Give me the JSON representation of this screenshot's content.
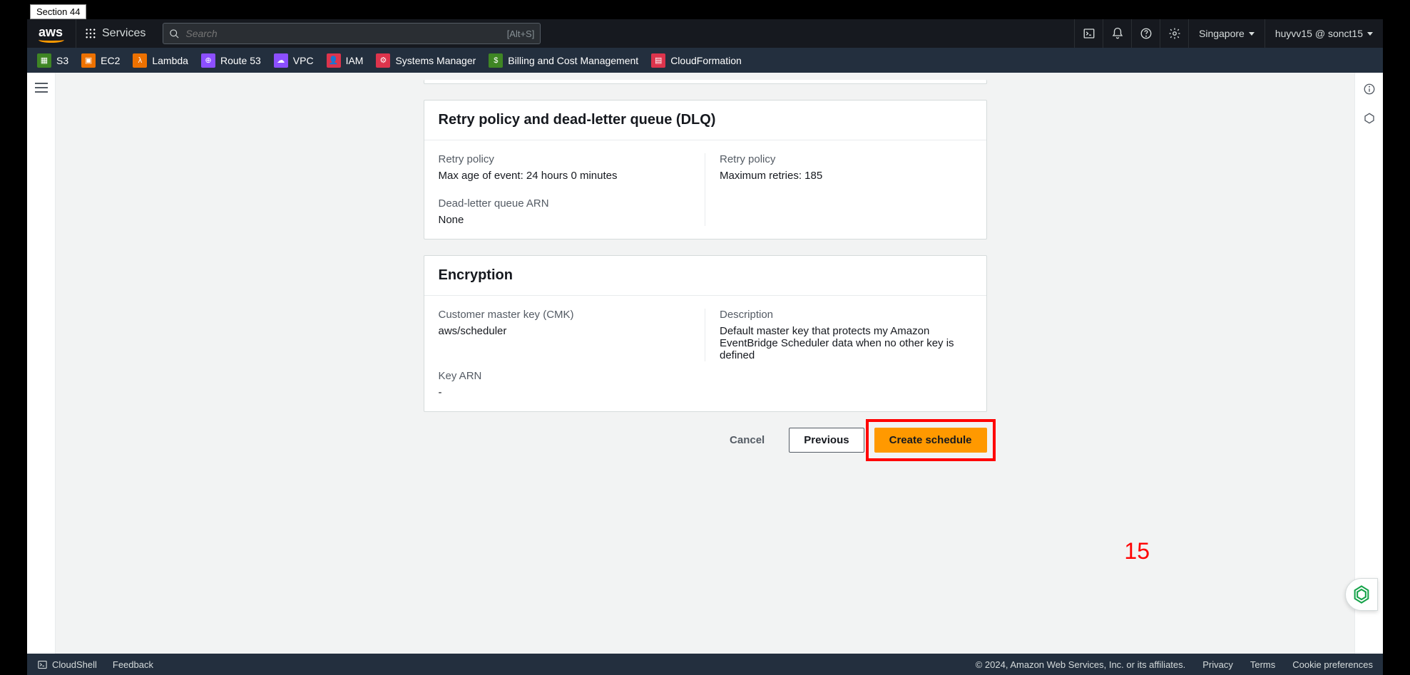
{
  "section_tag": "Section 44",
  "topbar": {
    "logo_text": "aws",
    "services_label": "Services",
    "search_placeholder": "Search",
    "search_shortcut": "[Alt+S]",
    "region": "Singapore",
    "user": "huyvv15 @ sonct15"
  },
  "favorites": [
    {
      "label": "S3"
    },
    {
      "label": "EC2"
    },
    {
      "label": "Lambda"
    },
    {
      "label": "Route 53"
    },
    {
      "label": "VPC"
    },
    {
      "label": "IAM"
    },
    {
      "label": "Systems Manager"
    },
    {
      "label": "Billing and Cost Management"
    },
    {
      "label": "CloudFormation"
    }
  ],
  "sections": {
    "retry": {
      "title": "Retry policy and dead-letter queue (DLQ)",
      "left": {
        "policy_label": "Retry policy",
        "policy_value": "Max age of event: 24 hours 0 minutes",
        "dlq_label": "Dead-letter queue ARN",
        "dlq_value": "None"
      },
      "right": {
        "policy_label": "Retry policy",
        "policy_value": "Maximum retries: 185"
      }
    },
    "encryption": {
      "title": "Encryption",
      "left": {
        "cmk_label": "Customer master key (CMK)",
        "cmk_value": "aws/scheduler",
        "arn_label": "Key ARN",
        "arn_value": "-"
      },
      "right": {
        "desc_label": "Description",
        "desc_value": "Default master key that protects my Amazon EventBridge Scheduler data when no other key is defined"
      }
    }
  },
  "footer_actions": {
    "cancel": "Cancel",
    "previous": "Previous",
    "create": "Create schedule"
  },
  "annotation_number": "15",
  "bottombar": {
    "cloudshell": "CloudShell",
    "feedback": "Feedback",
    "copyright": "© 2024, Amazon Web Services, Inc. or its affiliates.",
    "privacy": "Privacy",
    "terms": "Terms",
    "cookies": "Cookie preferences"
  }
}
